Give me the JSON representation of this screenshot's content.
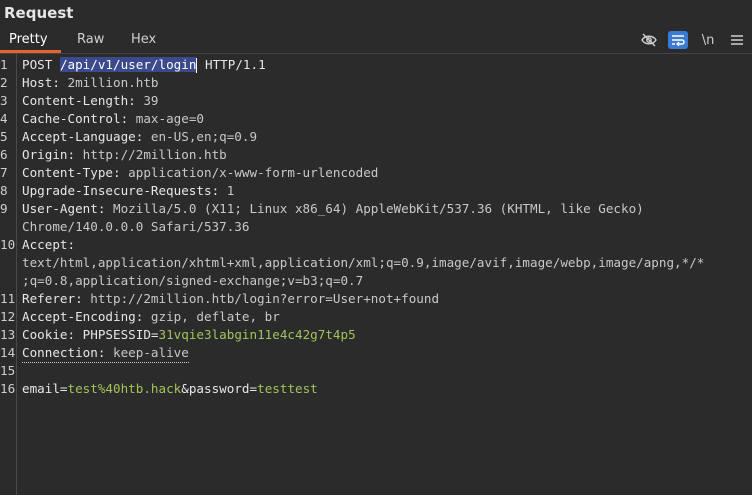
{
  "panel": {
    "title": "Request"
  },
  "tabs": [
    {
      "label": "Pretty"
    },
    {
      "label": "Raw"
    },
    {
      "label": "Hex"
    }
  ],
  "toolbar": {
    "hide_icon": "eye-slash-icon",
    "wrap_icon": "wrap-lines-icon",
    "newline_label": "\\n",
    "menu_icon": "hamburger-icon"
  },
  "request": {
    "line1": {
      "method": "POST",
      "path": "/api/v1/user/login",
      "version": "HTTP/1.1"
    },
    "headers": [
      {
        "name": "Host",
        "value": "2million.htb"
      },
      {
        "name": "Content-Length",
        "value": "39"
      },
      {
        "name": "Cache-Control",
        "value": "max-age=0"
      },
      {
        "name": "Accept-Language",
        "value": "en-US,en;q=0.9"
      },
      {
        "name": "Origin",
        "value": "http://2million.htb"
      },
      {
        "name": "Content-Type",
        "value": "application/x-www-form-urlencoded"
      },
      {
        "name": "Upgrade-Insecure-Requests",
        "value": "1"
      },
      {
        "name": "User-Agent",
        "value": "Mozilla/5.0 (X11; Linux x86_64) AppleWebKit/537.36 (KHTML, like Gecko)",
        "value2": "Chrome/140.0.0.0 Safari/537.36"
      },
      {
        "name": "Accept",
        "value": "",
        "value2": "text/html,application/xhtml+xml,application/xml;q=0.9,image/avif,image/webp,image/apng,*/*",
        "value3": ";q=0.8,application/signed-exchange;v=b3;q=0.7"
      },
      {
        "name": "Referer",
        "value": "http://2million.htb/login?error=User+not+found"
      },
      {
        "name": "Accept-Encoding",
        "value": "gzip, deflate, br"
      },
      {
        "name": "Cookie",
        "cookie_name": "PHPSESSID",
        "cookie_value": "31vqie3labgin11e4c42g7t4p5"
      },
      {
        "name": "Connection",
        "value": "keep-alive"
      }
    ],
    "body": {
      "k1": "email",
      "v1": "test%40htb.hack",
      "k2": "password",
      "v2": "testtest"
    }
  },
  "line_numbers": [
    "1",
    "2",
    "3",
    "4",
    "5",
    "6",
    "7",
    "8",
    "9",
    "10",
    "11",
    "12",
    "13",
    "14",
    "15",
    "16"
  ]
}
